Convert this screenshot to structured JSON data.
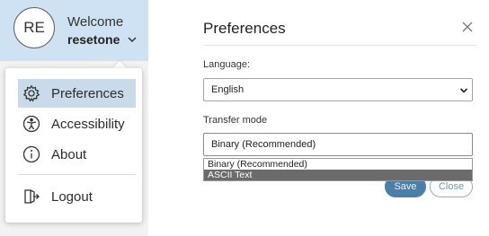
{
  "user": {
    "initials": "RE",
    "welcome": "Welcome",
    "username": "resetone"
  },
  "menu": {
    "items": [
      {
        "label": "Preferences",
        "icon": "gear-icon",
        "active": true
      },
      {
        "label": "Accessibility",
        "icon": "accessibility-icon",
        "active": false
      },
      {
        "label": "About",
        "icon": "info-icon",
        "active": false
      },
      {
        "label": "Logout",
        "icon": "logout-icon",
        "active": false
      }
    ]
  },
  "preferences": {
    "title": "Preferences",
    "language_label": "Language:",
    "language_value": "English",
    "transfer_label": "Transfer mode",
    "transfer_value": "Binary (Recommended)",
    "transfer_options": [
      "Binary (Recommended)",
      "ASCII Text"
    ],
    "highlighted_option": "ASCII Text",
    "save_label": "Save",
    "close_label": "Close"
  },
  "colors": {
    "header_bg": "#cfe2f3",
    "menu_active_bg": "#c9dbeb",
    "save_bg": "#4a7fa8",
    "close_border": "#8fb0c9",
    "option_highlight": "#6b6b6b"
  }
}
